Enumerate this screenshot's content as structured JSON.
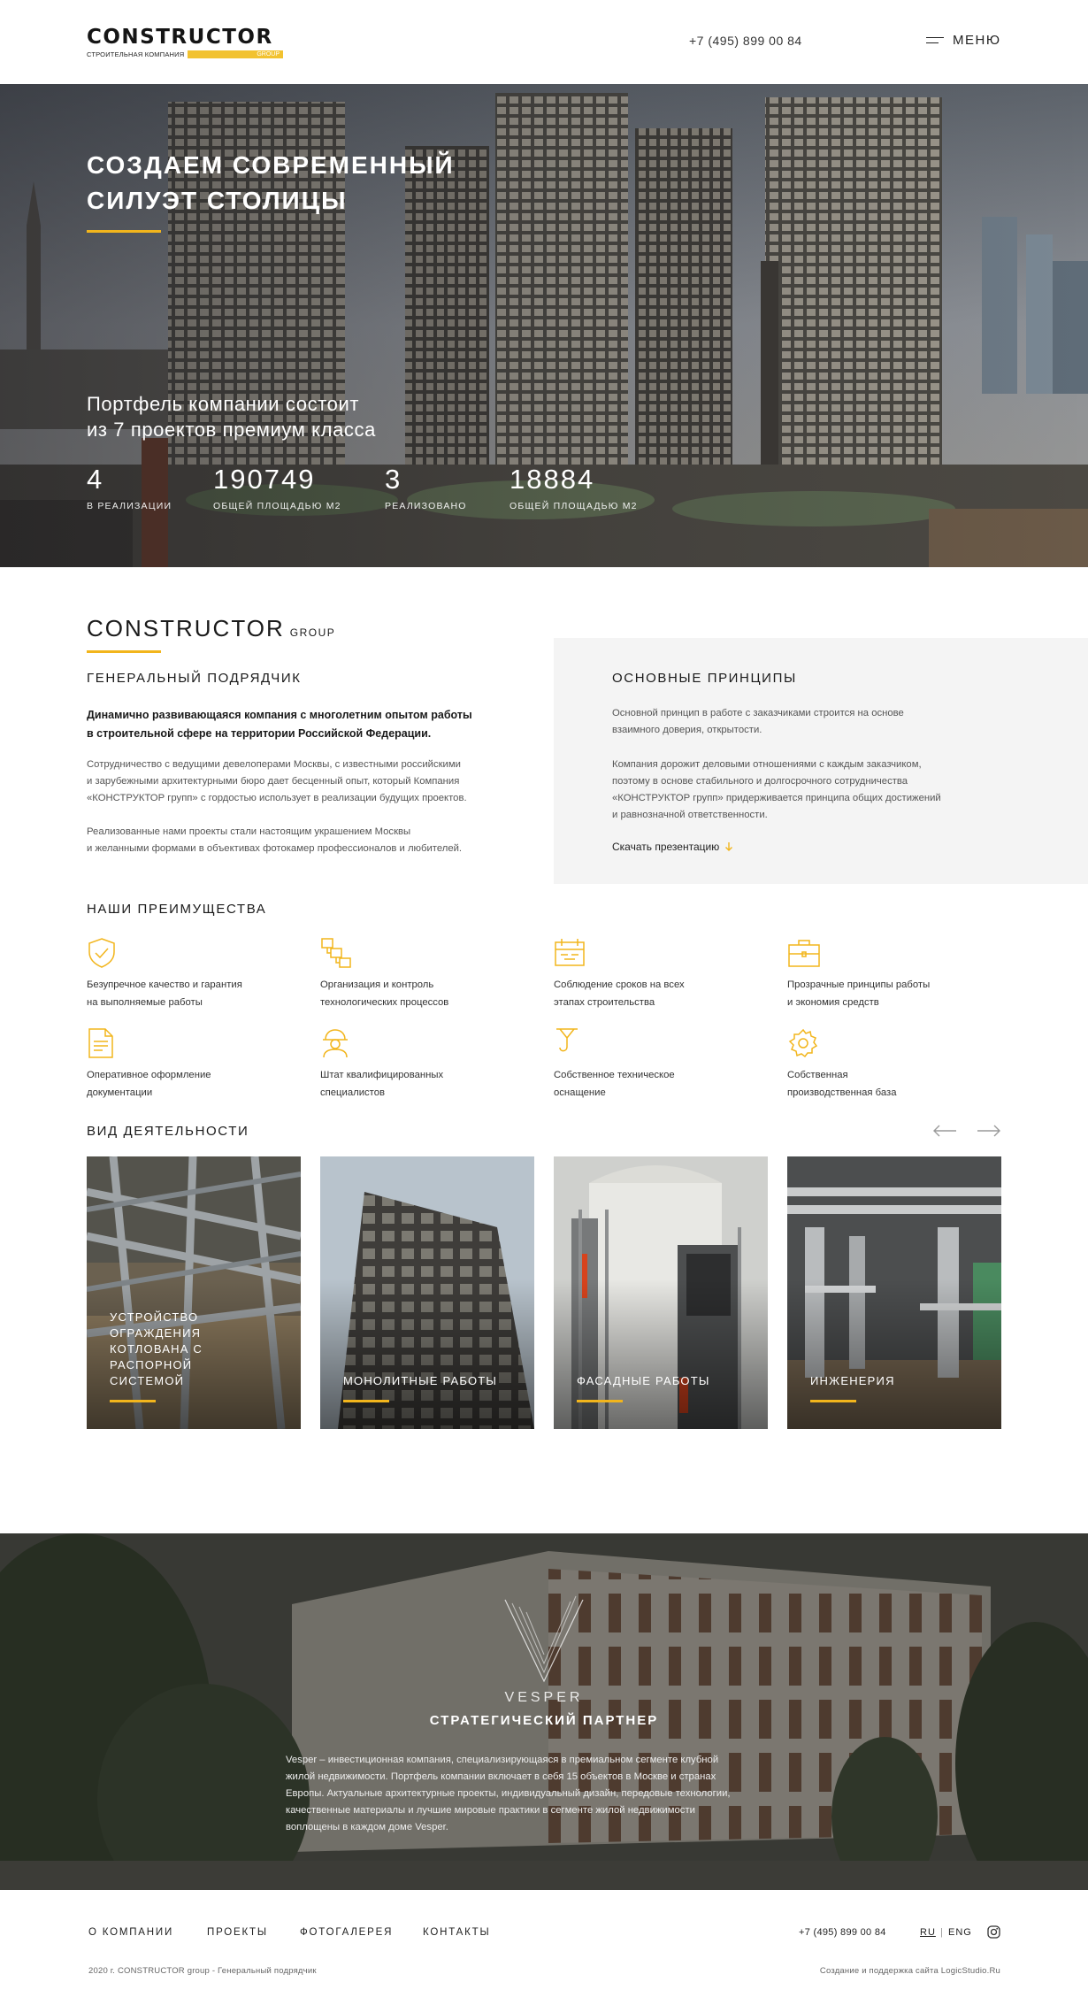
{
  "header": {
    "logo_word": "CONSTRUCTOR",
    "logo_sub": "СТРОИТЕЛЬНАЯ КОМПАНИЯ",
    "logo_tag": "GROUP",
    "phone": "+7 (495) 899 00 84",
    "menu_label": "МЕНЮ"
  },
  "hero": {
    "title": "Создаем современный силуэт столицы",
    "subtitle_line1": "Портфель компании состоит",
    "subtitle_line2": "из 7 проектов премиум класса",
    "stats": [
      {
        "value": "4",
        "label": "в реализации"
      },
      {
        "value": "190749",
        "label": "общей площадью м2"
      },
      {
        "value": "3",
        "label": "реализовано"
      },
      {
        "value": "18884",
        "label": "общей площадью м2"
      }
    ]
  },
  "about": {
    "brand": "CONSTRUCTOR",
    "brand_small": "GROUP",
    "left_heading": "Генеральный подрядчик",
    "lead_line1": "Динамично развивающаяся компания с многолетним опытом работы",
    "lead_line2": "в строительной сфере на территории Российской Федерации.",
    "p1_line1": "Сотрудничество с ведущими девелоперами Москвы, с известными российскими",
    "p1_line2": "и зарубежными архитектурными бюро дает бесценный опыт, который Компания",
    "p1_line3": "«КОНСТРУКТОР групп» с гордостью использует в реализации будущих проектов.",
    "p2_line1": "Реализованные нами проекты стали настоящим украшением Москвы",
    "p2_line2": "и желанными формами в объективах фотокамер профессионалов и любителей.",
    "principles_heading": "Основные принципы",
    "pr1_line1": "Основной принцип в работе с заказчиками строится на основе",
    "pr1_line2": "взаимного доверия, открытости.",
    "pr2_line1": "Компания дорожит деловыми отношениями с каждым заказчиком,",
    "pr2_line2": "поэтому в основе стабильного и долгосрочного сотрудничества",
    "pr2_line3": "«КОНСТРУКТОР групп» придерживается принципа общих достижений",
    "pr2_line4": "и равнозначной ответственности.",
    "download_label": "Скачать презентацию"
  },
  "advantages": {
    "heading": "Наши преимущества",
    "items": [
      {
        "icon": "shield-check-icon",
        "line1": "Безупречное качество и гарантия",
        "line2": "на выполняемые работы"
      },
      {
        "icon": "process-flow-icon",
        "line1": "Организация и контроль",
        "line2": "технологических процессов"
      },
      {
        "icon": "calendar-schedule-icon",
        "line1": "Соблюдение сроков на всех",
        "line2": "этапах строительства"
      },
      {
        "icon": "briefcase-icon",
        "line1": "Прозрачные принципы работы",
        "line2": "и экономия средств"
      },
      {
        "icon": "document-icon",
        "line1": "Оперативное оформление",
        "line2": "документации"
      },
      {
        "icon": "worker-helmet-icon",
        "line1": "Штат квалифицированных",
        "line2": "специалистов"
      },
      {
        "icon": "crane-hook-icon",
        "line1": "Собственное техническое",
        "line2": "оснащение"
      },
      {
        "icon": "gear-base-icon",
        "line1": "Собственная",
        "line2": "производственная база"
      }
    ]
  },
  "activities": {
    "heading": "Вид деятельности",
    "cards": [
      {
        "line1": "Устройство ограждения",
        "line2": "котлована с распорной",
        "line3": "системой"
      },
      {
        "line1": "Монолитные работы",
        "line2": "",
        "line3": ""
      },
      {
        "line1": "Фасадные работы",
        "line2": "",
        "line3": ""
      },
      {
        "line1": "Инженерия",
        "line2": "",
        "line3": ""
      }
    ]
  },
  "partner": {
    "logo_word": "VESPER",
    "heading": "Стратегический партнер",
    "text_line1": "Vesper – инвестиционная компания, специализирующаяся в премиальном сегменте клубной",
    "text_line2": "жилой недвижимости. Портфель компании включает в себя 15 объектов в Москве и странах",
    "text_line3": "Европы. Актуальные архитектурные проекты, индивидуальный дизайн, передовые технологии,",
    "text_line4": "качественные материалы и лучшие мировые практики в сегменте жилой недвижимости",
    "text_line5": "воплощены в каждом доме Vesper."
  },
  "footer": {
    "nav": [
      "О компании",
      "Проекты",
      "Фотогалерея",
      "Контакты"
    ],
    "phone": "+7 (495) 899 00 84",
    "lang_ru": "RU",
    "lang_sep": "|",
    "lang_en": "ENG",
    "copyright": "2020 г. CONSTRUCTOR group - Генеральный подрядчик",
    "credit": "Создание и поддержка сайта LogicStudio.Ru"
  },
  "colors": {
    "accent": "#f2b51c",
    "text": "#1f1f1f",
    "panel_bg": "#f4f4f4"
  }
}
